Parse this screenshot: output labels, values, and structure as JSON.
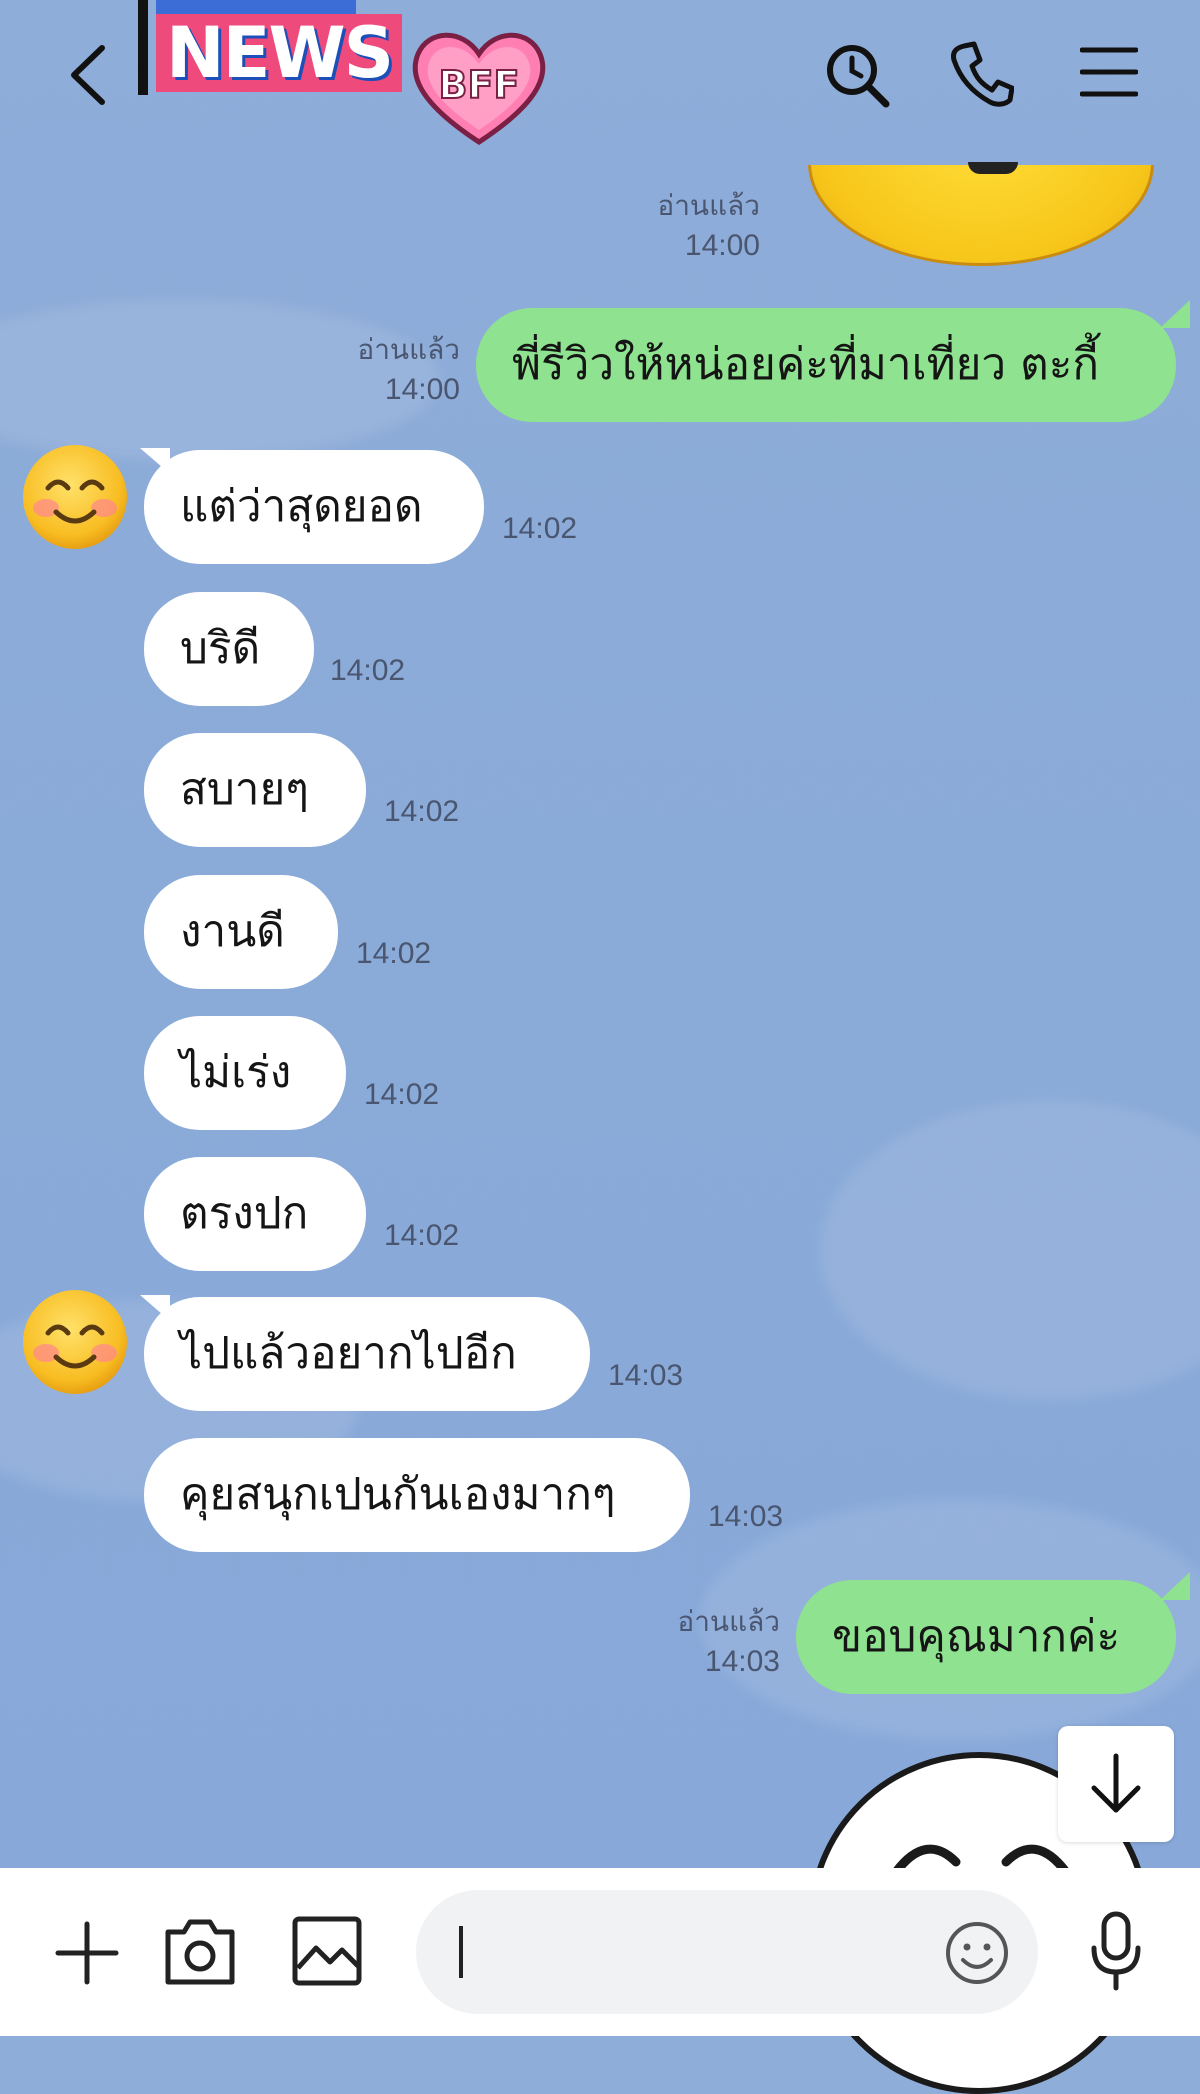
{
  "header": {
    "back_icon": "chevron-left-icon",
    "logo": {
      "news_text": "NEWS",
      "badge_text": "BFF"
    },
    "actions": [
      {
        "name": "search-icon"
      },
      {
        "name": "phone-icon"
      },
      {
        "name": "menu-icon"
      }
    ]
  },
  "messages": {
    "m0": {
      "read_label": "อ่านแล้ว",
      "time": "14:00"
    },
    "m1": {
      "text": "พี่รีวิวให้หน่อยค่ะที่มาเที่ยว ตะกี้",
      "read_label": "อ่านแล้ว",
      "time": "14:00"
    },
    "m2": {
      "text": "แต่ว่าสุดยอด",
      "time": "14:02"
    },
    "m3": {
      "text": "บริดี",
      "time": "14:02"
    },
    "m4": {
      "text": "สบายๆ",
      "time": "14:02"
    },
    "m5": {
      "text": "งานดี",
      "time": "14:02"
    },
    "m6": {
      "text": "ไม่เร่ง",
      "time": "14:02"
    },
    "m7": {
      "text": "ตรงปก",
      "time": "14:02"
    },
    "m8": {
      "text": "ไปแล้วอยากไปอีก",
      "time": "14:03"
    },
    "m9": {
      "text": "คุยสนุกเปนกันเองมากๆ",
      "time": "14:03"
    },
    "m10": {
      "text": "ขอบคุณมากค่ะ",
      "read_label": "อ่านแล้ว",
      "time": "14:03"
    }
  },
  "input": {
    "value": "",
    "placeholder": ""
  },
  "colors": {
    "background": "#8aaad8",
    "incoming_bubble": "#ffffff",
    "outgoing_bubble": "#8fe28f",
    "news_pink": "#ee4a7c",
    "badge_pink": "#ff7fb2"
  }
}
